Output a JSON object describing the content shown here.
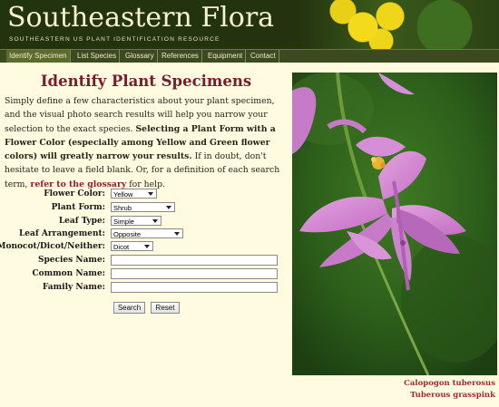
{
  "site": {
    "title": "Southeastern Flora",
    "subtitle": "SOUTHEASTERN US PLANT IDENTIFICATION RESOURCE"
  },
  "nav": {
    "items": [
      "Identify Specimen",
      "List Species",
      "Glossary",
      "References",
      "Equipment",
      "Contact"
    ],
    "active": "Identify Specimen"
  },
  "main": {
    "heading": "Identify Plant Specimens",
    "intro_1": "Simply define a few characteristics about your plant specimen, and the visual photo search results will help you narrow your selection to the exact species.",
    "intro_bold": "Selecting a Plant Form with a Flower Color (especially among Yellow and Green flower colors) will greatly narrow your results.",
    "intro_2": "If in doubt, don't hesitate to leave a field blank. Or, for a definition of each search term,",
    "intro_link": "refer to the glossary",
    "intro_3": "for help."
  },
  "form": {
    "flower_color": {
      "label": "Flower Color:",
      "value": "Yellow"
    },
    "plant_form": {
      "label": "Plant Form:",
      "value": "Shrub"
    },
    "leaf_type": {
      "label": "Leaf Type:",
      "value": "Simple"
    },
    "leaf_arrangement": {
      "label": "Leaf Arrangement:",
      "value": "Opposite"
    },
    "monocot_dicot": {
      "label": "Monocot/Dicot/Neither:",
      "value": "Dicot"
    },
    "species_name": {
      "label": "Species Name:",
      "value": ""
    },
    "common_name": {
      "label": "Common Name:",
      "value": ""
    },
    "family_name": {
      "label": "Family Name:",
      "value": ""
    },
    "search_label": "Search",
    "reset_label": "Reset"
  },
  "photo": {
    "scientific_name": "Calopogon tuberosus",
    "common_name": "Tuberous grasspink"
  }
}
